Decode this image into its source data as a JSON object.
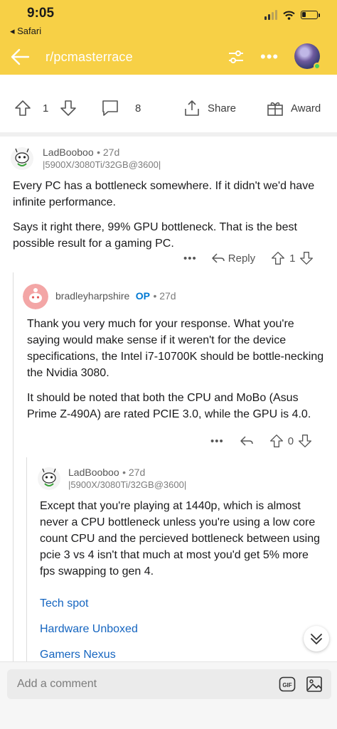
{
  "status_bar": {
    "time": "9:05",
    "back_app": "◂ Safari"
  },
  "header": {
    "subreddit": "r/pcmasterrace"
  },
  "post_actions": {
    "votes": "1",
    "comments": "8",
    "share": "Share",
    "award": "Award"
  },
  "comments": [
    {
      "author": "LadBooboo",
      "age": "• 27d",
      "flair": "|5900X/3080Ti/32GB@3600|",
      "paragraphs": [
        "Every PC has a bottleneck somewhere. If it didn't we'd have infinite performance.",
        "Says it right there, 99% GPU bottleneck. That is the best possible result for a gaming PC."
      ],
      "reply_label": "Reply",
      "votes": "1"
    },
    {
      "author": "bradleyharpshire",
      "op_badge": "OP",
      "age": "• 27d",
      "paragraphs": [
        "Thank you very much for your response. What you're saying would make sense if it weren't for the device specifications, the Intel i7-10700K should be bottle-necking the Nvidia 3080.",
        "It should be noted that both the CPU and MoBo (Asus Prime Z-490A) are rated PCIE 3.0, while the GPU is 4.0."
      ],
      "votes": "0"
    },
    {
      "author": "LadBooboo",
      "age": "• 27d",
      "flair": "|5900X/3080Ti/32GB@3600|",
      "paragraphs": [
        "Except that you're playing at 1440p, which is almost never a CPU bottleneck unless you're using a low core count CPU and the percieved bottleneck between using pcie 3 vs 4 isn't that much at most you'd get 5% more fps swapping to gen 4."
      ],
      "links": [
        "Tech spot",
        "Hardware Unboxed",
        "Gamers Nexus"
      ]
    }
  ],
  "composer": {
    "placeholder": "Add a comment"
  },
  "colors": {
    "header": "#f7d046",
    "op": "#0079d3",
    "link": "#1565c0"
  }
}
